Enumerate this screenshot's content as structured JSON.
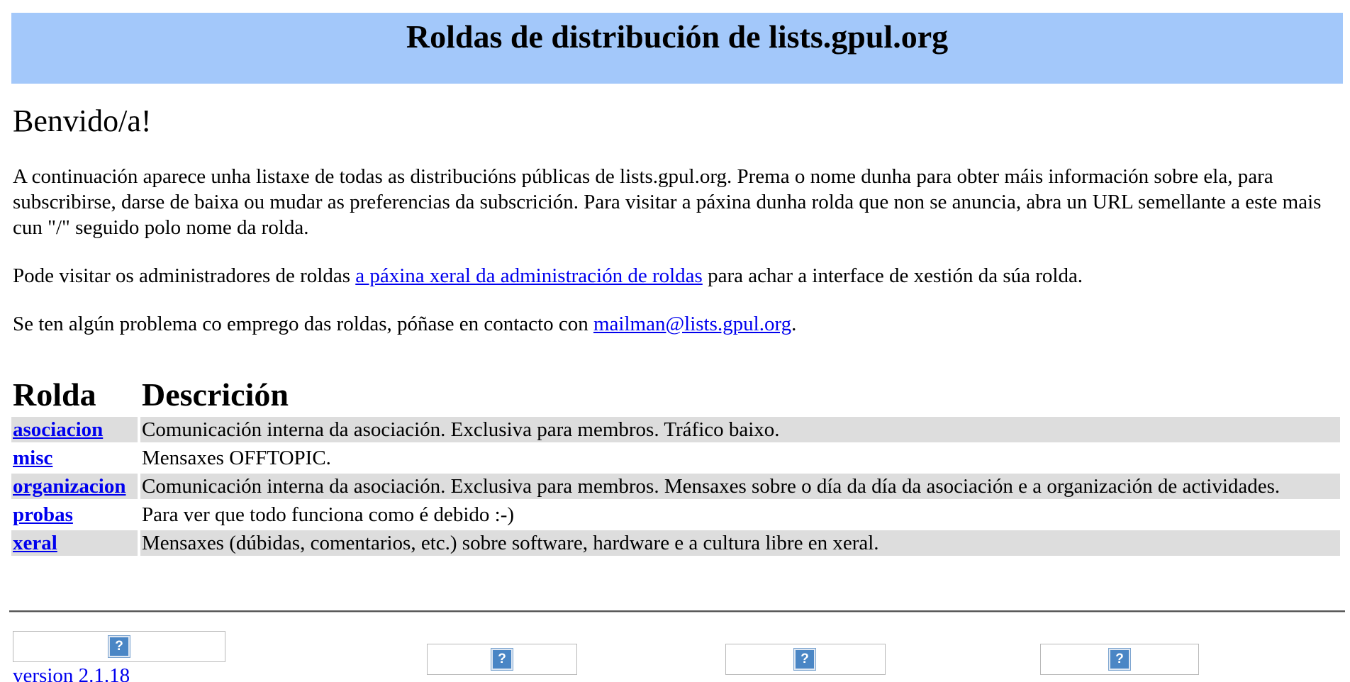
{
  "header": {
    "title": "Roldas de distribución de lists.gpul.org"
  },
  "welcome": "Benvido/a!",
  "intro": "A continuación aparece unha listaxe de todas as distribucións públicas de lists.gpul.org. Prema o nome dunha para obter máis información sobre ela, para subscribirse, darse de baixa ou mudar as preferencias da subscrición. Para visitar a páxina dunha rolda que non se anuncia, abra un URL semellante a este mais cun \"/\" seguido polo nome da rolda.",
  "admin": {
    "before": "Pode visitar os administradores de roldas ",
    "link": "a páxina xeral da administración de roldas",
    "after": " para achar a interface de xestión da súa rolda."
  },
  "contact": {
    "before": "Se ten algún problema co emprego das roldas, póñase en contacto con ",
    "link": "mailman@lists.gpul.org",
    "after": "."
  },
  "table": {
    "headers": [
      "Rolda",
      "Descrición"
    ],
    "rows": [
      {
        "name": "asociacion",
        "description": "Comunicación interna da asociación. Exclusiva para membros. Tráfico baixo."
      },
      {
        "name": "misc",
        "description": "Mensaxes OFFTOPIC."
      },
      {
        "name": "organizacion",
        "description": "Comunicación interna da asociación. Exclusiva para membros. Mensaxes sobre o día da día da asociación e a organización de actividades."
      },
      {
        "name": "probas",
        "description": "Para ver que todo funciona como é debido :-)"
      },
      {
        "name": "xeral",
        "description": "Mensaxes (dúbidas, comentarios, etc.) sobre software, hardware e a cultura libre en xeral."
      }
    ]
  },
  "footer": {
    "version_link": "version 2.1.18",
    "logo_icons": [
      "broken-image-icon",
      "broken-image-icon",
      "broken-image-icon",
      "broken-image-icon"
    ],
    "icon_glyph": "?"
  },
  "colors": {
    "banner": "#a3c8fa",
    "row_shade": "#dddddd",
    "link": "#0000ee",
    "icon": "#4a86c5"
  }
}
